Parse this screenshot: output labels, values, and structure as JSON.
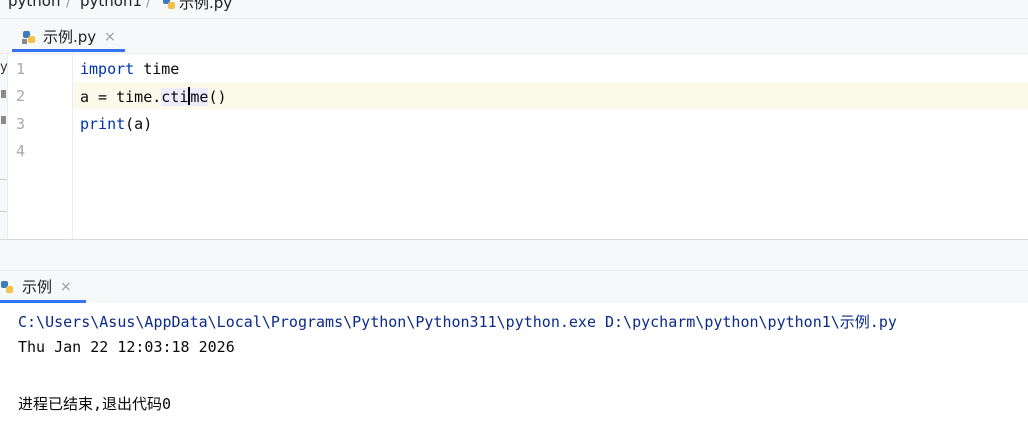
{
  "breadcrumb": {
    "items": [
      "python",
      "python1",
      "示例.py"
    ]
  },
  "editor_tab": {
    "label": "示例.py",
    "close_glyph": "×",
    "icon": "python-file-icon"
  },
  "editor": {
    "line_numbers": [
      "1",
      "2",
      "3",
      "4"
    ],
    "lines": [
      {
        "keyword": "import",
        "rest": " time"
      },
      {
        "before": "a = time.",
        "highlight_pre": "cti",
        "highlight_post": "me",
        "after": "()"
      },
      {
        "keyword": "print",
        "rest": "(a)"
      },
      {
        "text": ""
      }
    ],
    "caret_line": "2"
  },
  "run_panel": {
    "tab_label": "示例",
    "close_glyph": "×",
    "icon": "python-run-icon",
    "output": [
      "C:\\Users\\Asus\\AppData\\Local\\Programs\\Python\\Python311\\python.exe D:\\pycharm\\python\\python1\\示例.py",
      "Thu Jan 22 12:03:18 2026",
      "",
      "进程已结束,退出代码0"
    ]
  },
  "colors": {
    "accent": "#3574f0",
    "keyword": "#0033b3",
    "console_command": "#0a2a8a",
    "caret_row": "#fbf9ea"
  }
}
